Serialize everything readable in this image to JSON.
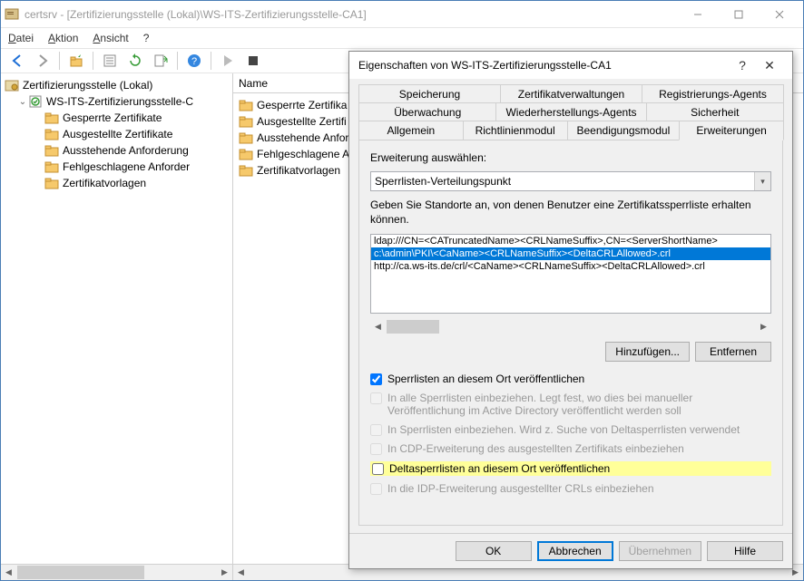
{
  "window": {
    "title": "certsrv - [Zertifizierungsstelle (Lokal)\\WS-ITS-Zertifizierungsstelle-CA1]"
  },
  "menubar": {
    "file": "Datei",
    "action": "Aktion",
    "view": "Ansicht",
    "help": "?"
  },
  "tree": {
    "root": "Zertifizierungsstelle (Lokal)",
    "ca": "WS-ITS-Zertifizierungsstelle-C",
    "items": [
      "Gesperrte Zertifikate",
      "Ausgestellte Zertifikate",
      "Ausstehende Anforderung",
      "Fehlgeschlagene Anforder",
      "Zertifikatvorlagen"
    ]
  },
  "list": {
    "header": "Name",
    "rows": [
      "Gesperrte Zertifika",
      "Ausgestellte Zertifi",
      "Ausstehende Anfor",
      "Fehlgeschlagene An",
      "Zertifikatvorlagen"
    ]
  },
  "dialog": {
    "title": "Eigenschaften von WS-ITS-Zertifizierungsstelle-CA1",
    "tabs_row1": [
      "Speicherung",
      "Zertifikatverwaltungen",
      "Registrierungs-Agents"
    ],
    "tabs_row2": [
      "Überwachung",
      "Wiederherstellungs-Agents",
      "Sicherheit"
    ],
    "tabs_row3": [
      "Allgemein",
      "Richtlinienmodul",
      "Beendigungsmodul",
      "Erweiterungen"
    ],
    "active_tab": "Erweiterungen",
    "select_label": "Erweiterung auswählen:",
    "select_value": "Sperrlisten-Verteilungspunkt",
    "desc": "Geben Sie Standorte an, von denen Benutzer eine Zertifikatssperrliste erhalten können.",
    "locations": [
      "ldap:///CN=<CATruncatedName><CRLNameSuffix>,CN=<ServerShortName>",
      "c:\\admin\\PKI\\<CaName><CRLNameSuffix><DeltaCRLAllowed>.crl",
      "http://ca.ws-its.de/crl/<CaName><CRLNameSuffix><DeltaCRLAllowed>.crl"
    ],
    "selected_location_index": 1,
    "add_btn": "Hinzufügen...",
    "remove_btn": "Entfernen",
    "checks": [
      {
        "label": "Sperrlisten an diesem Ort veröffentlichen",
        "checked": true,
        "enabled": true,
        "highlight": false
      },
      {
        "label": "In alle Sperrlisten einbeziehen. Legt fest, wo dies bei manueller Veröffentlichung im Active Directory veröffentlicht werden soll",
        "checked": false,
        "enabled": false,
        "highlight": false
      },
      {
        "label": "In Sperrlisten einbeziehen. Wird z. Suche von Deltasperrlisten verwendet",
        "checked": false,
        "enabled": false,
        "highlight": false
      },
      {
        "label": "In CDP-Erweiterung des ausgestellten Zertifikats einbeziehen",
        "checked": false,
        "enabled": false,
        "highlight": false
      },
      {
        "label": "Deltasperrlisten an diesem Ort veröffentlichen",
        "checked": false,
        "enabled": true,
        "highlight": true
      },
      {
        "label": "In die IDP-Erweiterung ausgestellter CRLs einbeziehen",
        "checked": false,
        "enabled": false,
        "highlight": false
      }
    ],
    "buttons": {
      "ok": "OK",
      "cancel": "Abbrechen",
      "apply": "Übernehmen",
      "help": "Hilfe"
    }
  }
}
